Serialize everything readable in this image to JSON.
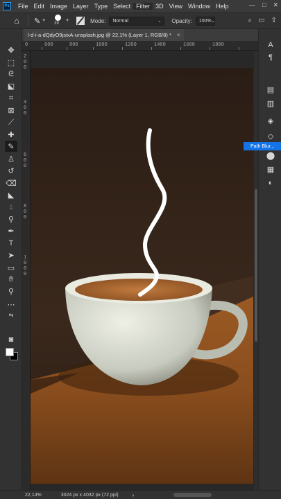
{
  "menubar": {
    "logo": "Ps",
    "items": [
      "File",
      "Edit",
      "Image",
      "Layer",
      "Type",
      "Select",
      "Filter",
      "3D",
      "View",
      "Window",
      "Help"
    ],
    "window_controls": [
      "—",
      "□",
      "✕"
    ]
  },
  "options": {
    "brush_size": "39",
    "mode_label": "Mode:",
    "mode_value": "Normal",
    "opacity_label": "Opacity:",
    "opacity_value": "100%"
  },
  "document": {
    "tab_title": "l-d-i-a-dQdyO9jsixA-unsplash.jpg @ 22,1% (Layer 1, RGB/8) *",
    "close": "×"
  },
  "rulers": {
    "h_ticks": [
      "0",
      "600",
      "800",
      "1000",
      "1200",
      "1400",
      "1600",
      "1800"
    ],
    "v_ticks": [
      "2",
      "0",
      "0",
      "4",
      "0",
      "0",
      "6",
      "0",
      "0",
      "8",
      "0",
      "0",
      "1",
      "0",
      "0",
      "0"
    ]
  },
  "tooltip": "Path Blur...",
  "status": {
    "zoom": "22,14%",
    "doc_info": "3024 px x 4032 px (72 ppi)",
    "arrow": "›"
  },
  "colors": {
    "foreground": "#ffffff",
    "background": "#000000",
    "accent": "#1473e6"
  }
}
